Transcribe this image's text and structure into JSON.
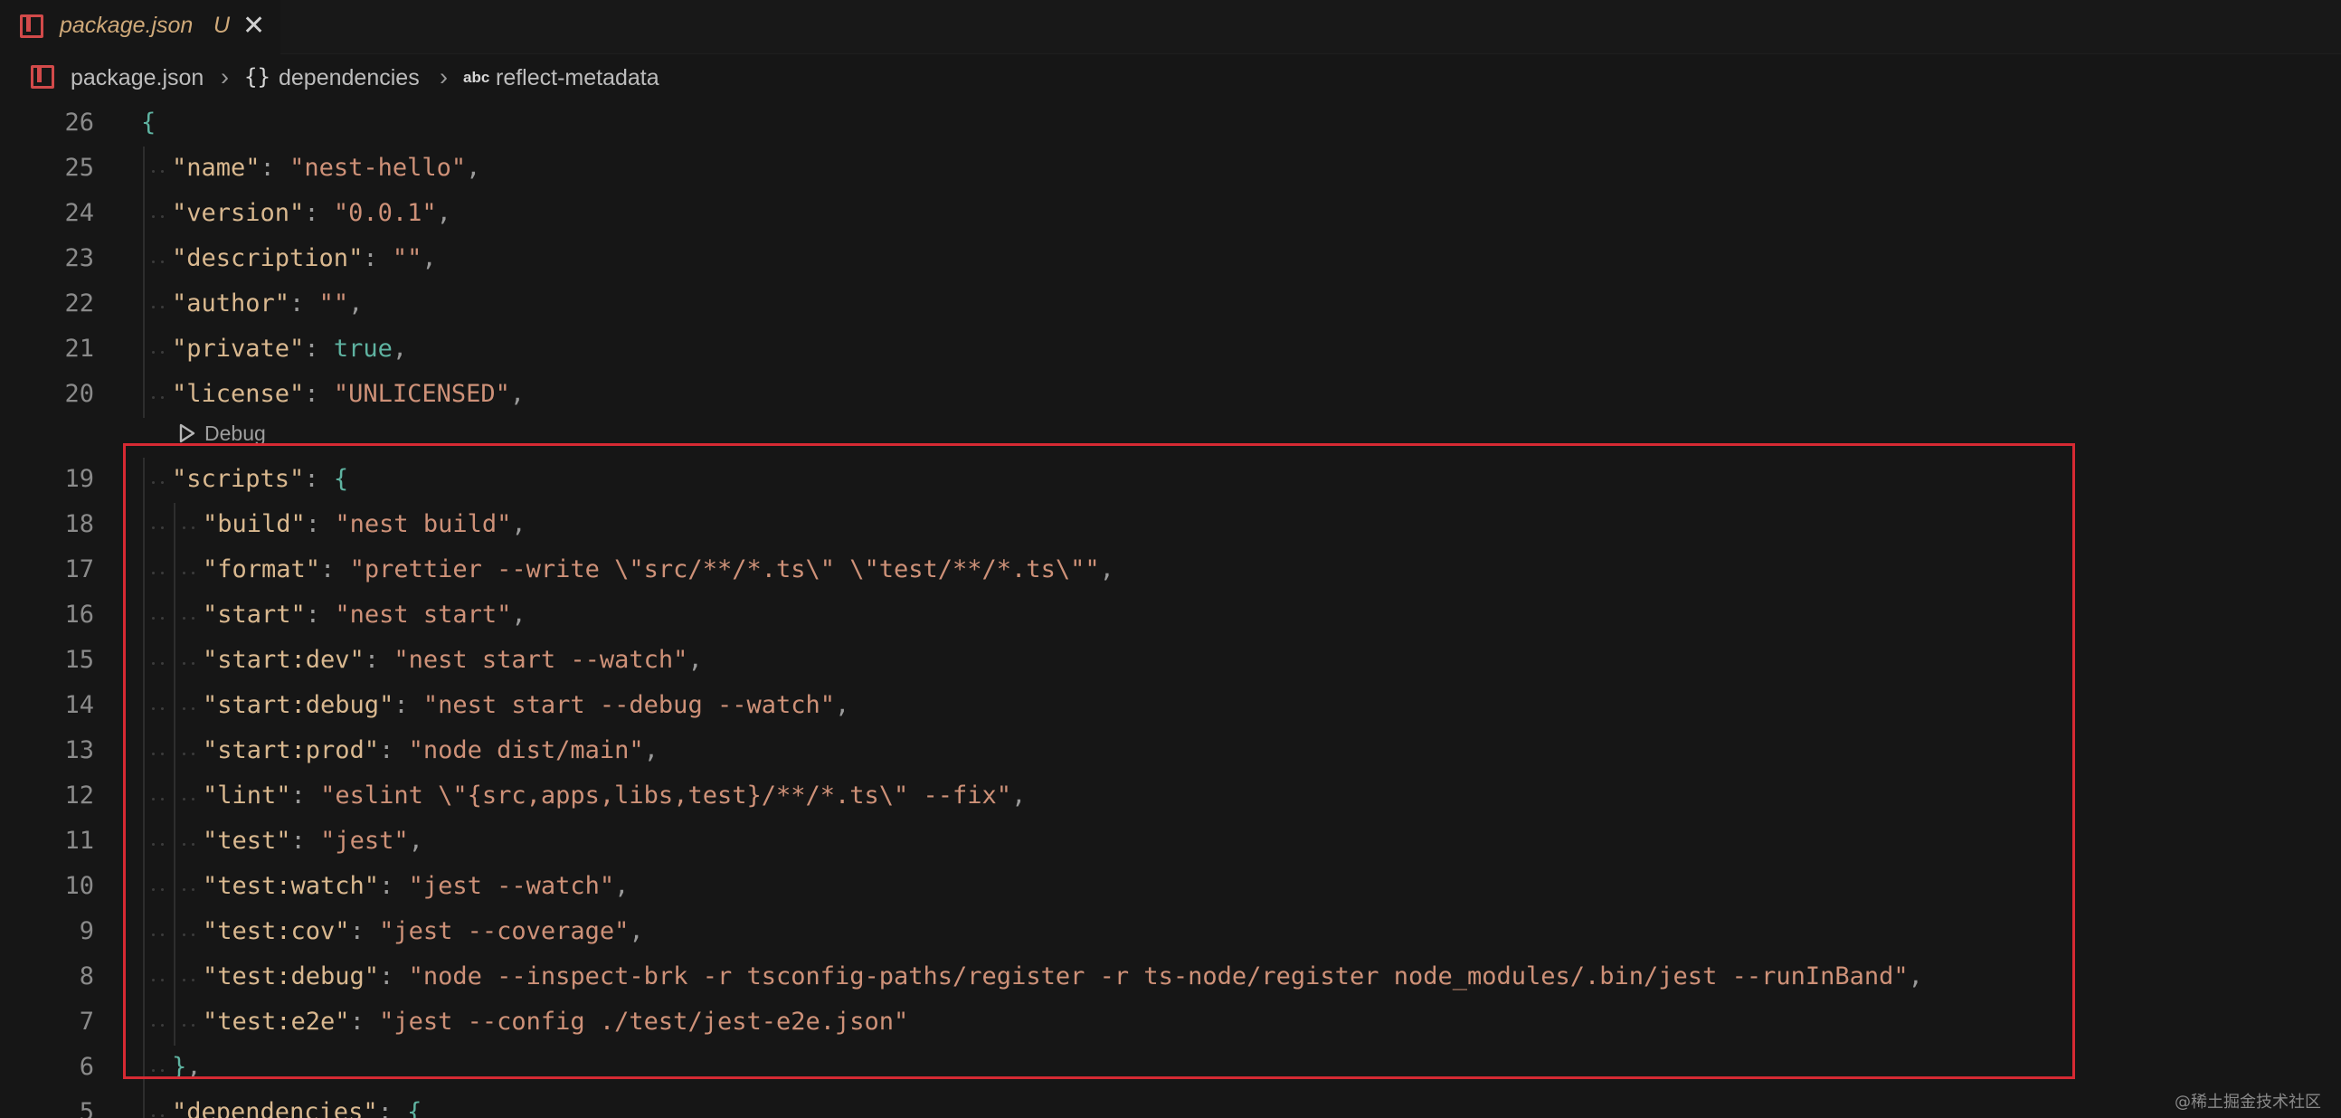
{
  "tab": {
    "label": "package.json",
    "status": "U",
    "close_glyph": "✕",
    "icon": "json-file-icon"
  },
  "breadcrumb": {
    "file": "package.json",
    "braces": "{}",
    "section": "dependencies",
    "abc": "abc",
    "leaf": "reflect-metadata"
  },
  "codelens": {
    "label": "Debug"
  },
  "lines": [
    {
      "num": "26",
      "indent": 0,
      "parts": [
        {
          "c": "b",
          "t": "{"
        }
      ]
    },
    {
      "num": "25",
      "indent": 1,
      "parts": [
        {
          "c": "k",
          "t": "\"name\""
        },
        {
          "c": "p",
          "t": ": "
        },
        {
          "c": "s",
          "t": "\"nest-hello\""
        },
        {
          "c": "p",
          "t": ","
        }
      ]
    },
    {
      "num": "24",
      "indent": 1,
      "parts": [
        {
          "c": "k",
          "t": "\"version\""
        },
        {
          "c": "p",
          "t": ": "
        },
        {
          "c": "s",
          "t": "\"0.0.1\""
        },
        {
          "c": "p",
          "t": ","
        }
      ]
    },
    {
      "num": "23",
      "indent": 1,
      "parts": [
        {
          "c": "k",
          "t": "\"description\""
        },
        {
          "c": "p",
          "t": ": "
        },
        {
          "c": "s",
          "t": "\"\""
        },
        {
          "c": "p",
          "t": ","
        }
      ]
    },
    {
      "num": "22",
      "indent": 1,
      "parts": [
        {
          "c": "k",
          "t": "\"author\""
        },
        {
          "c": "p",
          "t": ": "
        },
        {
          "c": "s",
          "t": "\"\""
        },
        {
          "c": "p",
          "t": ","
        }
      ]
    },
    {
      "num": "21",
      "indent": 1,
      "parts": [
        {
          "c": "k",
          "t": "\"private\""
        },
        {
          "c": "p",
          "t": ": "
        },
        {
          "c": "t",
          "t": "true"
        },
        {
          "c": "p",
          "t": ","
        }
      ]
    },
    {
      "num": "20",
      "indent": 1,
      "parts": [
        {
          "c": "k",
          "t": "\"license\""
        },
        {
          "c": "p",
          "t": ": "
        },
        {
          "c": "s",
          "t": "\"UNLICENSED\""
        },
        {
          "c": "p",
          "t": ","
        }
      ]
    },
    {
      "num": "19",
      "indent": 1,
      "parts": [
        {
          "c": "k",
          "t": "\"scripts\""
        },
        {
          "c": "p",
          "t": ": "
        },
        {
          "c": "b",
          "t": "{"
        }
      ]
    },
    {
      "num": "18",
      "indent": 2,
      "parts": [
        {
          "c": "k",
          "t": "\"build\""
        },
        {
          "c": "p",
          "t": ": "
        },
        {
          "c": "s",
          "t": "\"nest build\""
        },
        {
          "c": "p",
          "t": ","
        }
      ]
    },
    {
      "num": "17",
      "indent": 2,
      "parts": [
        {
          "c": "k",
          "t": "\"format\""
        },
        {
          "c": "p",
          "t": ": "
        },
        {
          "c": "s",
          "t": "\"prettier --write \\\"src/**/*.ts\\\" \\\"test/**/*.ts\\\"\""
        },
        {
          "c": "p",
          "t": ","
        }
      ]
    },
    {
      "num": "16",
      "indent": 2,
      "parts": [
        {
          "c": "k",
          "t": "\"start\""
        },
        {
          "c": "p",
          "t": ": "
        },
        {
          "c": "s",
          "t": "\"nest start\""
        },
        {
          "c": "p",
          "t": ","
        }
      ]
    },
    {
      "num": "15",
      "indent": 2,
      "parts": [
        {
          "c": "k",
          "t": "\"start:dev\""
        },
        {
          "c": "p",
          "t": ": "
        },
        {
          "c": "s",
          "t": "\"nest start --watch\""
        },
        {
          "c": "p",
          "t": ","
        }
      ]
    },
    {
      "num": "14",
      "indent": 2,
      "parts": [
        {
          "c": "k",
          "t": "\"start:debug\""
        },
        {
          "c": "p",
          "t": ": "
        },
        {
          "c": "s",
          "t": "\"nest start --debug --watch\""
        },
        {
          "c": "p",
          "t": ","
        }
      ]
    },
    {
      "num": "13",
      "indent": 2,
      "parts": [
        {
          "c": "k",
          "t": "\"start:prod\""
        },
        {
          "c": "p",
          "t": ": "
        },
        {
          "c": "s",
          "t": "\"node dist/main\""
        },
        {
          "c": "p",
          "t": ","
        }
      ]
    },
    {
      "num": "12",
      "indent": 2,
      "parts": [
        {
          "c": "k",
          "t": "\"lint\""
        },
        {
          "c": "p",
          "t": ": "
        },
        {
          "c": "s",
          "t": "\"eslint \\\"{src,apps,libs,test}/**/*.ts\\\" --fix\""
        },
        {
          "c": "p",
          "t": ","
        }
      ]
    },
    {
      "num": "11",
      "indent": 2,
      "parts": [
        {
          "c": "k",
          "t": "\"test\""
        },
        {
          "c": "p",
          "t": ": "
        },
        {
          "c": "s",
          "t": "\"jest\""
        },
        {
          "c": "p",
          "t": ","
        }
      ]
    },
    {
      "num": "10",
      "indent": 2,
      "parts": [
        {
          "c": "k",
          "t": "\"test:watch\""
        },
        {
          "c": "p",
          "t": ": "
        },
        {
          "c": "s",
          "t": "\"jest --watch\""
        },
        {
          "c": "p",
          "t": ","
        }
      ]
    },
    {
      "num": "9",
      "indent": 2,
      "parts": [
        {
          "c": "k",
          "t": "\"test:cov\""
        },
        {
          "c": "p",
          "t": ": "
        },
        {
          "c": "s",
          "t": "\"jest --coverage\""
        },
        {
          "c": "p",
          "t": ","
        }
      ]
    },
    {
      "num": "8",
      "indent": 2,
      "parts": [
        {
          "c": "k",
          "t": "\"test:debug\""
        },
        {
          "c": "p",
          "t": ": "
        },
        {
          "c": "s",
          "t": "\"node --inspect-brk -r tsconfig-paths/register -r ts-node/register node_modules/.bin/jest --runInBand\""
        },
        {
          "c": "p",
          "t": ","
        }
      ]
    },
    {
      "num": "7",
      "indent": 2,
      "parts": [
        {
          "c": "k",
          "t": "\"test:e2e\""
        },
        {
          "c": "p",
          "t": ": "
        },
        {
          "c": "s",
          "t": "\"jest --config ./test/jest-e2e.json\""
        }
      ]
    },
    {
      "num": "6",
      "indent": 1,
      "parts": [
        {
          "c": "b",
          "t": "}"
        },
        {
          "c": "p",
          "t": ","
        }
      ]
    },
    {
      "num": "5",
      "indent": 1,
      "parts": [
        {
          "c": "k",
          "t": "\"dependencies\""
        },
        {
          "c": "p",
          "t": ": "
        },
        {
          "c": "b",
          "t": "{"
        }
      ]
    }
  ],
  "watermark": "@稀土掘金技术社区",
  "colors": {
    "key": "#d9b88f",
    "string": "#ce9178",
    "bracket": "#5fb3a1",
    "highlight": "#d62a33"
  }
}
